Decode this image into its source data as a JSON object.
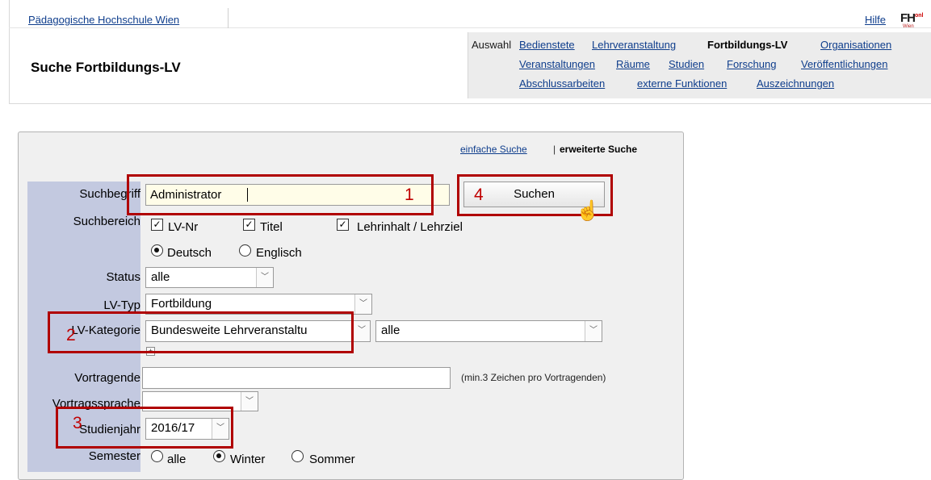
{
  "header": {
    "institution": "Pädagogische Hochschule Wien",
    "help": "Hilfe",
    "logo": "FH",
    "logo_sup": "onl",
    "logo_sub": "Wien",
    "page_title": "Suche Fortbildungs-LV"
  },
  "nav": {
    "selection_label": "Auswahl",
    "row1": [
      "Bedienstete",
      "Lehrveranstaltung",
      "Fortbildungs-LV",
      "Organisationen"
    ],
    "row2": [
      "Veranstaltungen",
      "Räume",
      "Studien",
      "Forschung",
      "Veröffentlichungen"
    ],
    "row3": [
      "Abschlussarbeiten",
      "externe Funktionen",
      "Auszeichnungen"
    ]
  },
  "search_mode": {
    "simple": "einfache Suche",
    "separator": "|",
    "advanced": "erweiterte Suche"
  },
  "form": {
    "search_term_label": "Suchbegriff",
    "search_term_value": "Administrator",
    "search_button": "Suchen",
    "search_area_label": "Suchbereich",
    "area_options": [
      "LV-Nr",
      "Titel",
      "Lehrinhalt / Lehrziel"
    ],
    "languages": [
      "Deutsch",
      "Englisch"
    ],
    "status_label": "Status",
    "status_value": "alle",
    "lv_type_label": "LV-Typ",
    "lv_type_value": "Fortbildung",
    "lv_category_label": "LV-Kategorie",
    "lv_category_value": "Bundesweite Lehrveranstaltu",
    "lv_category_sub_value": "alle",
    "lecturers_label": "Vortragende",
    "lecturers_value": "",
    "lecturers_hint": "(min.3 Zeichen pro Vortragenden)",
    "lecture_language_label": "Vortragssprache",
    "lecture_language_value": "",
    "study_year_label": "Studienjahr",
    "study_year_value": "2016/17",
    "semester_label": "Semester",
    "semester_options": [
      "alle",
      "Winter",
      "Sommer"
    ],
    "semester_selected": "Winter"
  },
  "annotations": {
    "callouts": [
      "1",
      "2",
      "3",
      "4"
    ],
    "color": "#b00000"
  }
}
